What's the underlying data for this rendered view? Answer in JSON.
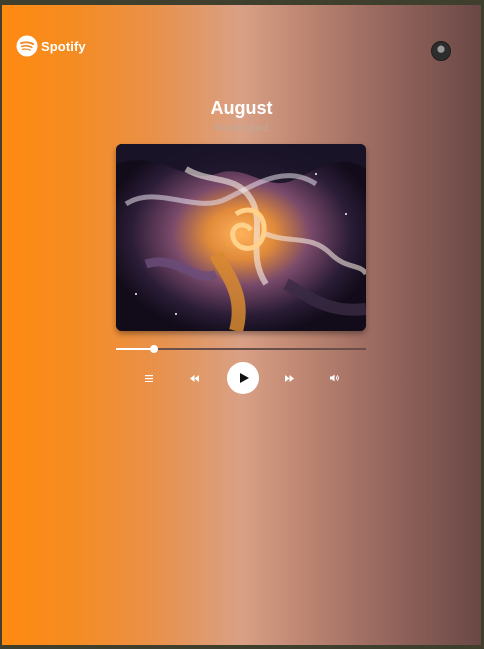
{
  "brand": {
    "name": "Spotify",
    "trademark": "®"
  },
  "track": {
    "title": "August",
    "artist": "Mockingbird"
  },
  "player": {
    "progress": 0.15,
    "state": "paused"
  },
  "icons": {
    "logo": "spotify-logo-icon",
    "avatar": "user-avatar",
    "queue": "list-icon",
    "previous": "rewind-icon",
    "play": "play-icon",
    "next": "fast-forward-icon",
    "volume": "volume-icon"
  },
  "colors": {
    "gradient_start": "#ff8a10",
    "gradient_mid": "#d9a085",
    "gradient_end": "#6a4745",
    "accent": "#ffffff"
  }
}
